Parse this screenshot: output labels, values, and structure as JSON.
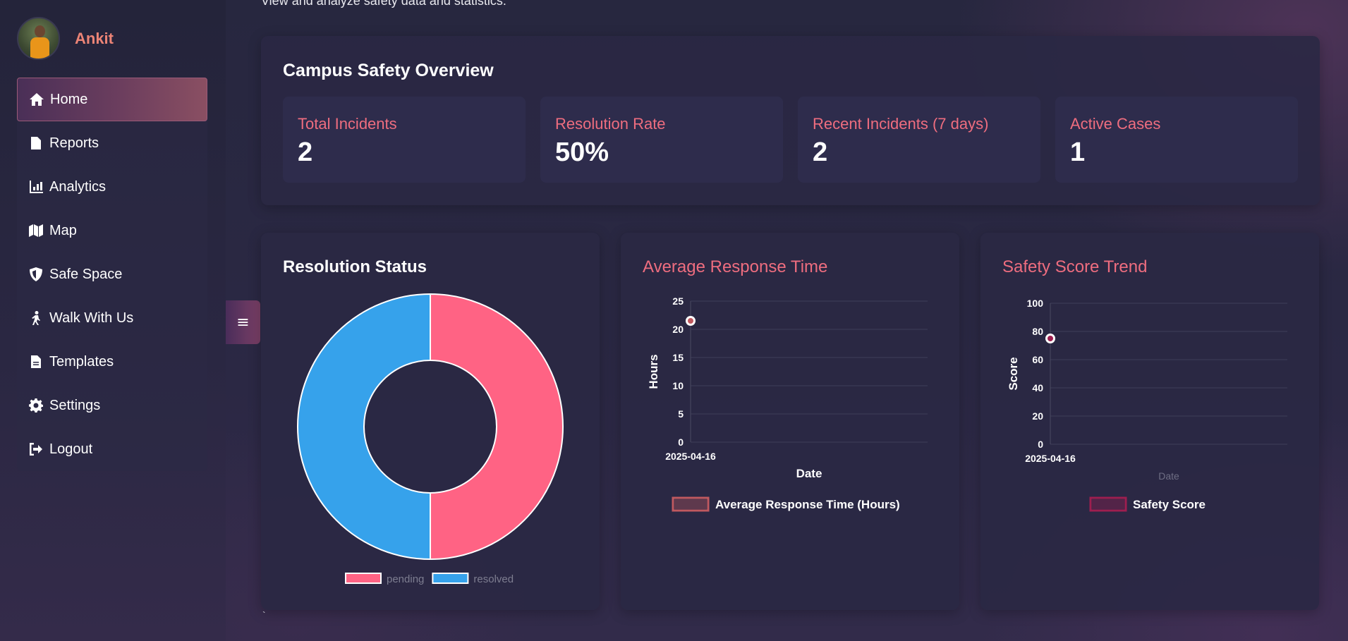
{
  "user": {
    "name": "Ankit"
  },
  "nav": {
    "items": [
      {
        "label": "Home",
        "icon": "home-icon",
        "active": true
      },
      {
        "label": "Reports",
        "icon": "file-icon"
      },
      {
        "label": "Analytics",
        "icon": "chart-icon"
      },
      {
        "label": "Map",
        "icon": "map-icon"
      },
      {
        "label": "Safe Space",
        "icon": "shield-icon"
      },
      {
        "label": "Walk With Us",
        "icon": "walking-icon"
      },
      {
        "label": "Templates",
        "icon": "document-icon"
      },
      {
        "label": "Settings",
        "icon": "gear-icon"
      },
      {
        "label": "Logout",
        "icon": "logout-icon"
      }
    ],
    "toggle_icon": "≡"
  },
  "page": {
    "subtitle": "View and analyze safety data and statistics.",
    "backtick": "`"
  },
  "overview": {
    "title": "Campus Safety Overview",
    "stats": [
      {
        "label": "Total Incidents",
        "value": "2"
      },
      {
        "label": "Resolution Rate",
        "value": "50%"
      },
      {
        "label": "Recent Incidents (7 days)",
        "value": "2"
      },
      {
        "label": "Active Cases",
        "value": "1"
      }
    ]
  },
  "colors": {
    "accent": "#ee6d7f",
    "pending": "#ff6384",
    "resolved": "#36a2eb",
    "response_line": "#c0595f",
    "safety_line": "#9e1e4f"
  },
  "chart_data": [
    {
      "type": "pie",
      "title": "Resolution Status",
      "donut": true,
      "labels": [
        "pending",
        "resolved"
      ],
      "values": [
        1,
        1
      ],
      "legend": "bottom"
    },
    {
      "type": "line",
      "title": "Average Response Time",
      "x": [
        "2025-04-16"
      ],
      "series": [
        {
          "name": "Average Response Time (Hours)",
          "values": [
            21.5
          ]
        }
      ],
      "xlabel": "Date",
      "ylabel": "Hours",
      "ylim": [
        0,
        25
      ],
      "yticks": [
        0,
        5,
        10,
        15,
        20,
        25
      ],
      "grid": true,
      "legend": "bottom"
    },
    {
      "type": "line",
      "title": "Safety Score Trend",
      "x": [
        "2025-04-16"
      ],
      "series": [
        {
          "name": "Safety Score",
          "values": [
            75
          ]
        }
      ],
      "xlabel": "Date",
      "ylabel": "Score",
      "ylim": [
        0,
        100
      ],
      "yticks": [
        0,
        20,
        40,
        60,
        80,
        100
      ],
      "grid": true,
      "legend": "bottom"
    }
  ]
}
